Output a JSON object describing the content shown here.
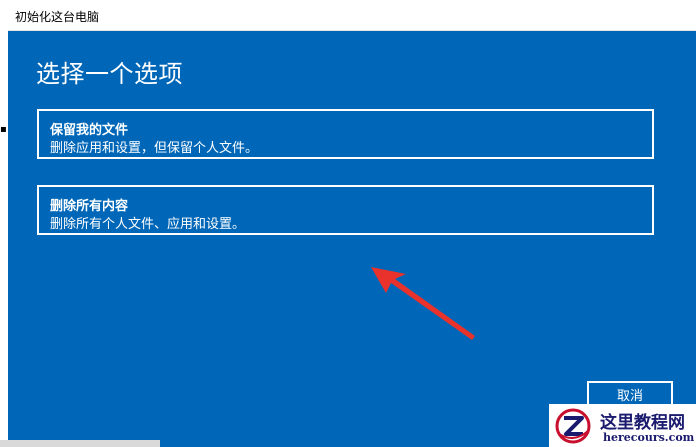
{
  "window": {
    "title": "初始化这台电脑",
    "heading": "选择一个选项"
  },
  "options": [
    {
      "title": "保留我的文件",
      "description": "删除应用和设置，但保留个人文件。"
    },
    {
      "title": "删除所有内容",
      "description": "删除所有个人文件、应用和设置。"
    }
  ],
  "buttons": {
    "cancel": "取消"
  },
  "watermark": {
    "name": "这里教程网",
    "url": "herecours.com"
  },
  "colors": {
    "background": "#0067b8",
    "text": "#ffffff",
    "arrow": "#e8322b"
  },
  "icons": {
    "annotation": "red-arrow-icon",
    "logo": "z-logo-icon"
  }
}
